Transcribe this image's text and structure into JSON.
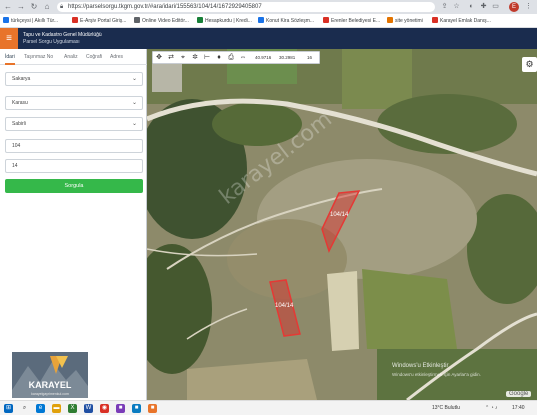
{
  "browser": {
    "url": "https://parselsorgu.tkgm.gov.tr/#ara/idari/155563/104/14/1672929405807",
    "profile_initial": "E",
    "bookmarks": [
      {
        "label": "türkçeysi | Akıllı Tür...",
        "color": "#1a73e8"
      },
      {
        "label": "E-Arşiv Portal Giriş...",
        "color": "#d93025"
      },
      {
        "label": "Online Video Editör...",
        "color": "#5f6368"
      },
      {
        "label": "Hesapkurdu | Kredi...",
        "color": "#188038"
      },
      {
        "label": "Konut Kira Sözleşm...",
        "color": "#1a73e8"
      },
      {
        "label": "Erenler Belediyesi E...",
        "color": "#d93025"
      },
      {
        "label": "site yönetimi",
        "color": "#e37400"
      },
      {
        "label": "Karayel Emlak Danış...",
        "color": "#d93025"
      }
    ]
  },
  "app": {
    "title_line1": "Tapu ve Kadastro Genel Müdürlüğü",
    "title_line2": "Parsel Sorgu Uygulaması",
    "accent": "#e8742a",
    "header_bg": "#1a2c4e"
  },
  "sidebar": {
    "tabs": [
      "İdari",
      "Taşınmaz No",
      "Analiz",
      "Coğrafi",
      "Adres"
    ],
    "province": "Sakarya",
    "district": "Karasu",
    "neighborhood": "Sabirli",
    "block": "104",
    "parcel": "14",
    "search_button": "Sorgula",
    "search_color": "#35b84a",
    "logo_text": "KARAYEL",
    "logo_sub": "karayelgayrimenkul.com"
  },
  "map": {
    "coord_x": "40.9716",
    "coord_y": "30.2981",
    "zoom_level": "16",
    "parcel_labels": [
      "104/14",
      "104/14"
    ],
    "watermark": "karayel.com",
    "activate_line1": "Windows'u Etkinleştir",
    "activate_line2": "Windows'u etkinleştirmek için Ayarlar'a gidin.",
    "google_label": "Google"
  },
  "taskbar": {
    "weather": "13°C  Bulutlu",
    "clock": "17:40"
  }
}
